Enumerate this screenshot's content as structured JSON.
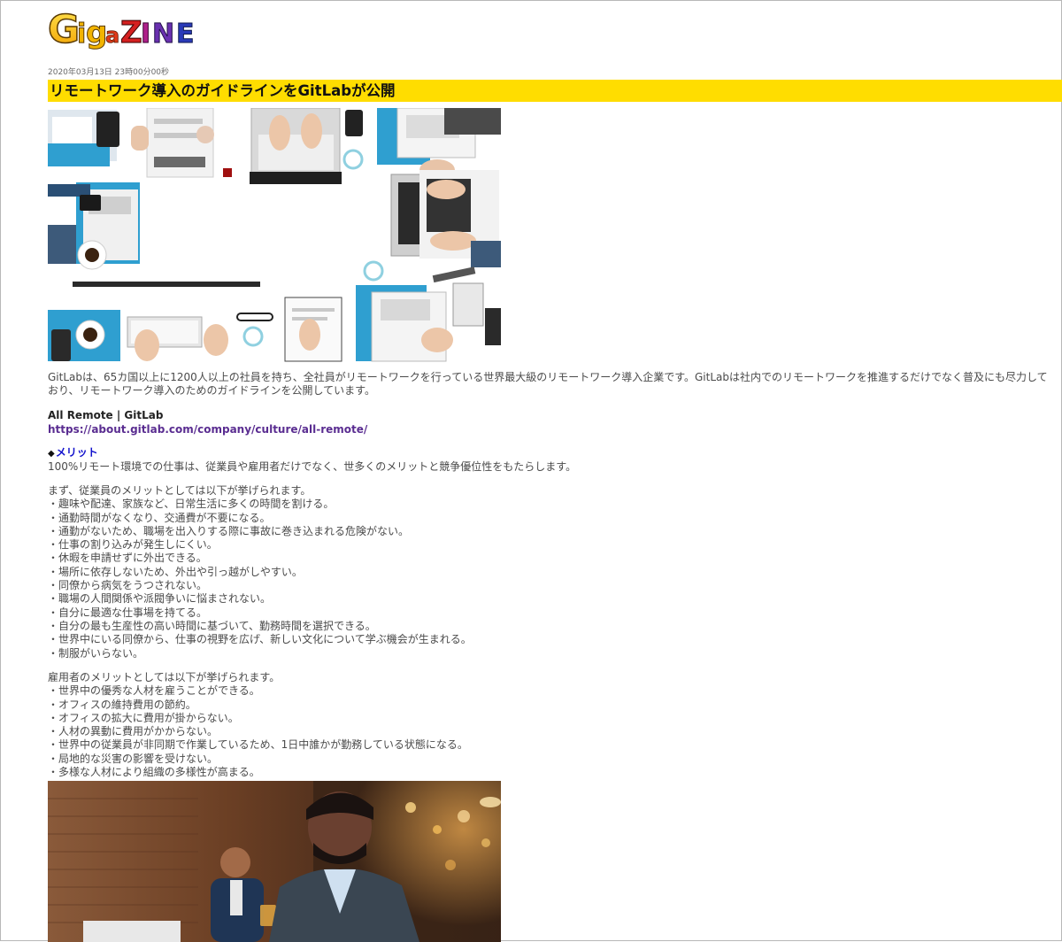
{
  "site": {
    "logo_text": "Gigazine"
  },
  "article": {
    "date": "2020年03月13日 23時00分00秒",
    "title": "リモートワーク導入のガイドラインをGitLabが公開",
    "intro": "GitLabは、65カ国以上に1200人以上の社員を持ち、全社員がリモートワークを行っている世界最大級のリモートワーク導入企業です。GitLabは社内でのリモートワークを推進するだけでなく普及にも尽力しており、リモートワーク導入のためのガイドラインを公開しています。",
    "link": {
      "title": "All Remote | GitLab",
      "url": "https://about.gitlab.com/company/culture/all-remote/"
    },
    "section": {
      "bullet": "◆",
      "heading": "メリット",
      "lead": "100%リモート環境での仕事は、従業員や雇用者だけでなく、世多くのメリットと競争優位性をもたらします。"
    },
    "employee": {
      "intro": "まず、従業員のメリットとしては以下が挙げられます。",
      "items": [
        "・趣味や配達、家族など、日常生活に多くの時間を割ける。",
        "・通勤時間がなくなり、交通費が不要になる。",
        "・通勤がないため、職場を出入りする際に事故に巻き込まれる危険がない。",
        "・仕事の割り込みが発生しにくい。",
        "・休暇を申請せずに外出できる。",
        "・場所に依存しないため、外出や引っ越がしやすい。",
        "・同僚から病気をうつされない。",
        "・職場の人間関係や派閥争いに悩まされない。",
        "・自分に最適な仕事場を持てる。",
        "・自分の最も生産性の高い時間に基づいて、勤務時間を選択できる。",
        "・世界中にいる同僚から、仕事の視野を広げ、新しい文化について学ぶ機会が生まれる。",
        "・制服がいらない。"
      ]
    },
    "employer": {
      "intro": "雇用者のメリットとしては以下が挙げられます。",
      "items": [
        "・世界中の優秀な人材を雇うことができる。",
        "・オフィスの維持費用の節約。",
        "・オフィスの拡大に費用が掛からない。",
        "・人材の異動に費用がかからない。",
        "・世界中の従業員が非同期で作業しているため、1日中誰かが勤務している状態になる。",
        "・局地的な災害の影響を受けない。",
        "・多様な人材により組織の多様性が高まる。"
      ]
    }
  },
  "colors": {
    "title_bg": "#ffdd00",
    "link": "#5a2d91",
    "heading": "#1111cc"
  }
}
